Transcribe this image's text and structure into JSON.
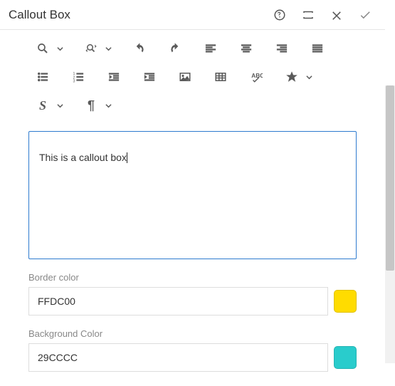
{
  "header": {
    "title": "Callout Box"
  },
  "editor": {
    "text": "This is a callout box"
  },
  "fields": {
    "border": {
      "label": "Border color",
      "value": "FFDC00",
      "swatch": "#FFDC00"
    },
    "background": {
      "label": "Background Color",
      "value": "29CCCC",
      "swatch": "#29CCCC"
    }
  },
  "scroll": {
    "thumb_top": 0,
    "thumb_height": 260
  }
}
